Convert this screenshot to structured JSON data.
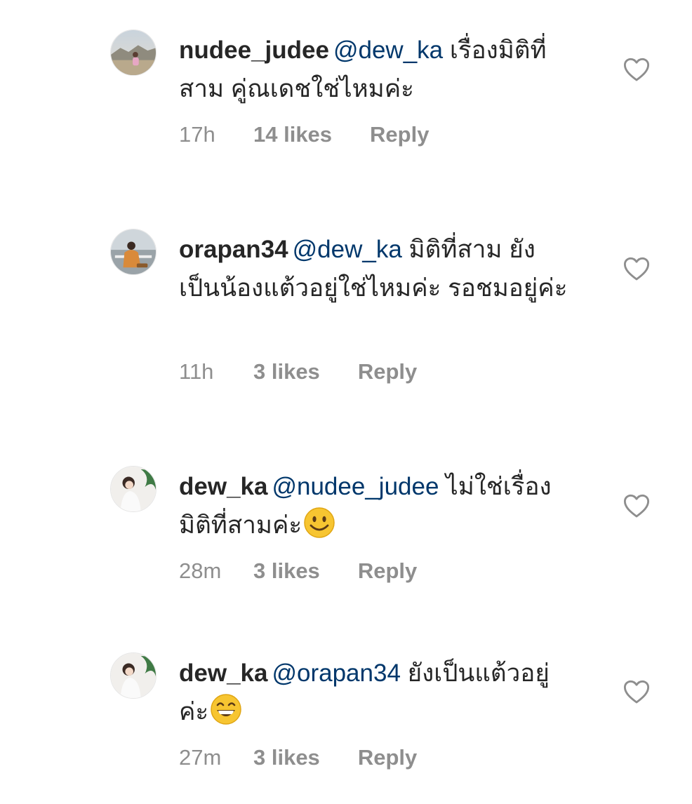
{
  "comments": [
    {
      "username": "nudee_judee",
      "mention": "@dew_ka",
      "text": "เรื่องมิติที่สาม คู่ณเดชใช่ไหมค่ะ",
      "time": "17h",
      "likes": "14 likes",
      "reply": "Reply",
      "emoji": ""
    },
    {
      "username": "orapan34",
      "mention": "@dew_ka",
      "text": "มิติที่สาม ยังเป็นน้องแต้วอยู่ใช่ไหมค่ะ รอชมอยู่ค่ะ",
      "time": "11h",
      "likes": "3 likes",
      "reply": "Reply",
      "emoji": ""
    },
    {
      "username": "dew_ka",
      "mention": "@nudee_judee",
      "text": "ไม่ใช่เรื่องมิติที่สามค่ะ",
      "time": "28m",
      "likes": "3 likes",
      "reply": "Reply",
      "emoji": "smiley-face-emoji"
    },
    {
      "username": "dew_ka",
      "mention": "@orapan34",
      "text": "ยังเป็นแต้วอยู่ค่ะ",
      "time": "27m",
      "likes": "3 likes",
      "reply": "Reply",
      "emoji": "grinning-face-emoji"
    }
  ],
  "colors": {
    "text": "#262626",
    "mention": "#00376b",
    "meta": "#8e8e8e"
  },
  "icons": {
    "like": "heart-outline-icon"
  }
}
